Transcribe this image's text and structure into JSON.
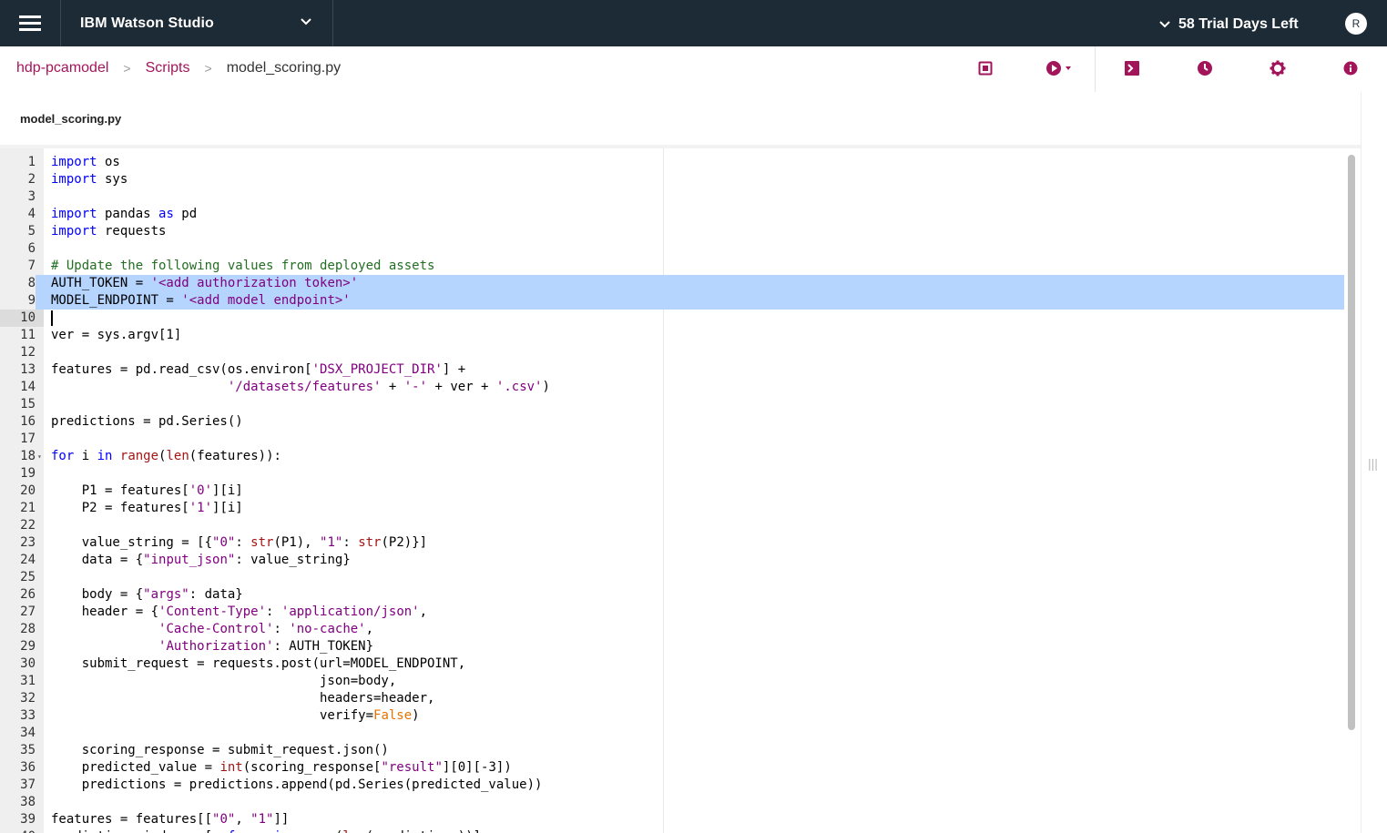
{
  "topbar": {
    "product_name": "IBM Watson Studio",
    "trial_text": "58 Trial Days Left",
    "avatar_initial": "R"
  },
  "breadcrumb": {
    "project": "hdp-pcamodel",
    "section": "Scripts",
    "file": "model_scoring.py"
  },
  "toolbar": {
    "icons": [
      "save-icon",
      "run-icon",
      "terminal-icon",
      "history-icon",
      "settings-icon",
      "info-icon"
    ]
  },
  "file_header": {
    "title": "model_scoring.py"
  },
  "editor": {
    "selected_lines": [
      8,
      9
    ],
    "active_line": 10,
    "lines": [
      "import os",
      "import sys",
      "",
      "import pandas as pd",
      "import requests",
      "",
      "# Update the following values from deployed assets",
      "AUTH_TOKEN = '<add authorization token>'",
      "MODEL_ENDPOINT = '<add model endpoint>'",
      "",
      "ver = sys.argv[1]",
      "",
      "features = pd.read_csv(os.environ['DSX_PROJECT_DIR'] +",
      "                       '/datasets/features' + '-' + ver + '.csv')",
      "",
      "predictions = pd.Series()",
      "",
      "for i in range(len(features)):",
      "",
      "    P1 = features['0'][i]",
      "    P2 = features['1'][i]",
      "",
      "    value_string = [{\"0\": str(P1), \"1\": str(P2)}]",
      "    data = {\"input_json\": value_string}",
      "",
      "    body = {\"args\": data}",
      "    header = {'Content-Type': 'application/json',",
      "              'Cache-Control': 'no-cache',",
      "              'Authorization': AUTH_TOKEN}",
      "    submit_request = requests.post(url=MODEL_ENDPOINT,",
      "                                   json=body,",
      "                                   headers=header,",
      "                                   verify=False)",
      "",
      "    scoring_response = submit_request.json()",
      "    predicted_value = int(scoring_response[\"result\"][0][-3])",
      "    predictions = predictions.append(pd.Series(predicted_value))",
      "",
      "features = features[[\"0\", \"1\"]]",
      "predictions.index = [x for x in range(len(predictions))]"
    ]
  }
}
